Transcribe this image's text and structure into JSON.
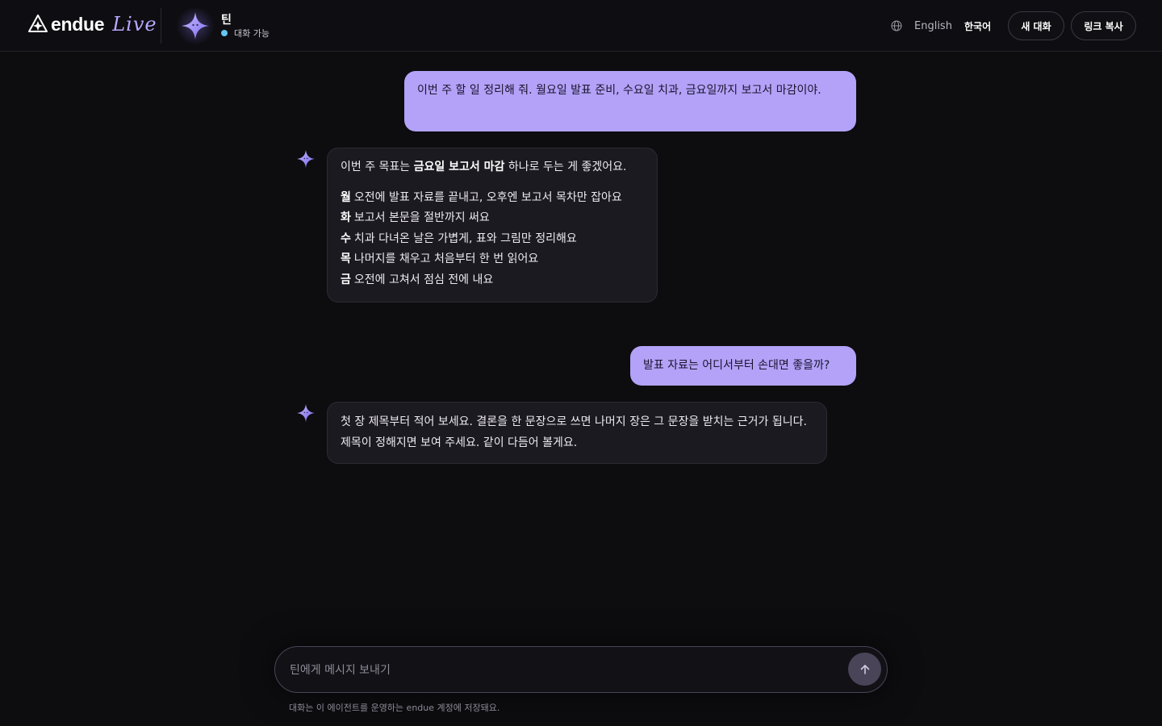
{
  "header": {
    "brand_name": "endue",
    "brand_live": "Live",
    "agent_name": "틴",
    "agent_status": "대화 가능",
    "lang_en": "English",
    "lang_ko": "한국어",
    "new_chat_label": "새 대화",
    "copy_link_label": "링크 복사"
  },
  "messages": {
    "user_1": "이번 주 할 일 정리해 줘. 월요일 발표 준비, 수요일 치과, 금요일까지 보고서 마감이야.",
    "bot_1": {
      "intro_before": "이번 주 목표는 ",
      "intro_bold": "금요일 보고서 마감",
      "intro_after": " 하나로 두는 게 좋겠어요.",
      "days": [
        {
          "key": "월",
          "text": "오전에 발표 자료를 끝내고, 오후엔 보고서 목차만 잡아요"
        },
        {
          "key": "화",
          "text": "보고서 본문을 절반까지 써요"
        },
        {
          "key": "수",
          "text": "치과 다녀온 날은 가볍게, 표와 그림만 정리해요"
        },
        {
          "key": "목",
          "text": "나머지를 채우고 처음부터 한 번 읽어요"
        },
        {
          "key": "금",
          "text": "오전에 고쳐서 점심 전에 내요"
        }
      ]
    },
    "user_2": "발표 자료는 어디서부터 손대면 좋을까?",
    "bot_2": "첫 장 제목부터 적어 보세요. 결론을 한 문장으로 쓰면 나머지 장은 그 문장을 받치는 근거가 됩니다. 제목이 정해지면 보여 주세요. 같이 다듬어 볼게요."
  },
  "composer": {
    "placeholder": "틴에게 메시지 보내기",
    "footnote": "대화는 이 에이전트를 운영하는 endue 계정에 저장돼요."
  },
  "colors": {
    "user_bubble": "#b3a2f7",
    "bot_bubble": "#1b1a20",
    "status_dot": "#62c7f0",
    "accent": "#b9a8ff"
  },
  "icons": [
    "endue-logo-icon",
    "agent-sparkle-icon",
    "globe-icon",
    "arrow-up-icon"
  ]
}
